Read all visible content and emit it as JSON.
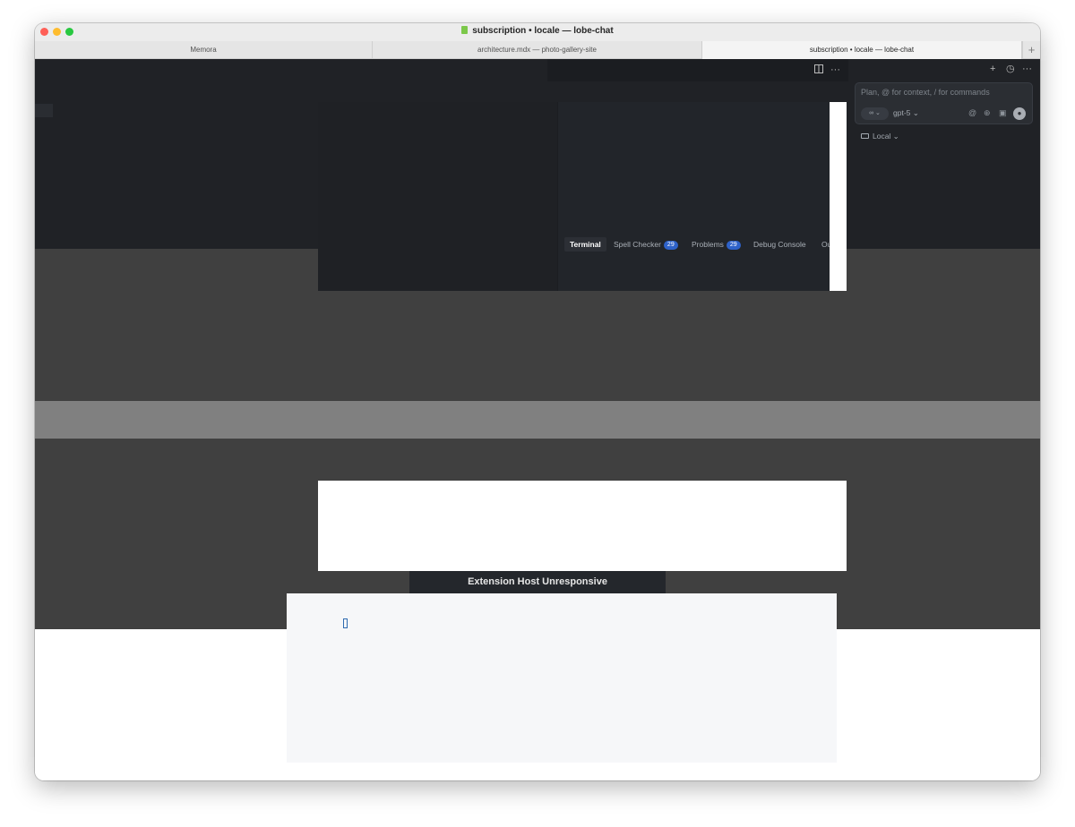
{
  "window": {
    "title": "subscription • locale — lobe-chat"
  },
  "tabs": [
    {
      "label": "Memora",
      "active": false
    },
    {
      "label": "architecture.mdx — photo-gallery-site",
      "active": false
    },
    {
      "label": "subscription • locale — lobe-chat",
      "active": true
    }
  ],
  "tab_add_label": "+",
  "editor_toolbar": {
    "split_icon": "split-editor-icon",
    "more_label": "···"
  },
  "panel": {
    "tabs": [
      {
        "label": "Terminal",
        "active": true
      },
      {
        "label": "Spell Checker",
        "badge": "29"
      },
      {
        "label": "Problems",
        "badge": "29"
      },
      {
        "label": "Debug Console"
      },
      {
        "label": "Ou"
      }
    ]
  },
  "chat": {
    "top_icons": {
      "new": "+",
      "history": "◷",
      "more": "···"
    },
    "input_placeholder": "Plan, @ for context, / for commands",
    "mode_label": "∞ ⌄",
    "model_label": "gpt-5 ⌄",
    "icons": {
      "at": "@",
      "globe": "⊕",
      "image": "▣",
      "mic": "●"
    },
    "environment_label": "Local ⌄"
  },
  "dialog": {
    "title": "Extension Host Unresponsive"
  },
  "colors": {
    "editor_bg": "#202226",
    "dim_overlay": "#404040",
    "badge": "#2e62c9",
    "traffic_close": "#ff5f57",
    "traffic_min": "#febc2e",
    "traffic_max": "#28c840"
  }
}
